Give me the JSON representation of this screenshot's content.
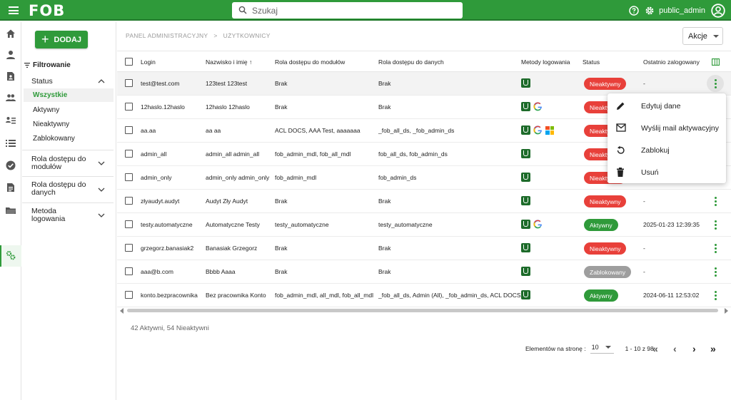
{
  "app": {
    "logo": "FOB",
    "user": "public_admin"
  },
  "search": {
    "placeholder": "Szukaj"
  },
  "sidebar": {
    "add_label": "DODAJ",
    "filter_title": "Filtrowanie"
  },
  "filters": {
    "status": {
      "label": "Status",
      "options": [
        "Wszystkie",
        "Aktywny",
        "Nieaktywny",
        "Zablokowany"
      ],
      "selected": "Wszystkie"
    },
    "rola_modulow": {
      "line1": "Rola dostępu do",
      "line2": "modułów"
    },
    "rola_danych": {
      "line1": "Rola dostępu do",
      "line2": "danych"
    },
    "metoda": {
      "line1": "Metoda",
      "line2": "logowania"
    }
  },
  "breadcrumb": {
    "level1": "PANEL ADMINISTRACYJNY",
    "sep": ">",
    "level2": "UŻYTKOWNICY"
  },
  "actions": {
    "label": "Akcje"
  },
  "table": {
    "headers": {
      "login": "Login",
      "name": "Nazwisko i imię",
      "sort_arrow": "↑",
      "role_modules": "Rola dostępu do modułów",
      "role_data": "Rola dostępu do danych",
      "methods": "Metody logowania",
      "status": "Status",
      "last_login": "Ostatnio zalogowany"
    },
    "rows": [
      {
        "login": "test@test.com",
        "name": "123test 123test",
        "role_modules": "Brak",
        "role_data": "Brak",
        "methods": [
          "fob"
        ],
        "status": "Nieaktywny",
        "status_color": "#e8403a",
        "last": "-"
      },
      {
        "login": "12haslo.12haslo",
        "name": "12haslo 12haslo",
        "role_modules": "Brak",
        "role_data": "Brak",
        "methods": [
          "fob",
          "google"
        ],
        "status": "Nieaktywny",
        "status_color": "#e8403a",
        "last": ""
      },
      {
        "login": "aa.aa",
        "name": "aa aa",
        "role_modules": "ACL DOCS, AAA Test, aaaaaaa",
        "role_data": "_fob_all_ds, _fob_admin_ds",
        "methods": [
          "fob",
          "google",
          "microsoft"
        ],
        "status": "Nieaktywny",
        "status_color": "#e8403a",
        "last": ""
      },
      {
        "login": "admin_all",
        "name": "admin_all admin_all",
        "role_modules": "fob_admin_mdl, fob_all_mdl",
        "role_data": "fob_all_ds, fob_admin_ds",
        "methods": [
          "fob"
        ],
        "status": "Nieaktywny",
        "status_color": "#e8403a",
        "last": ""
      },
      {
        "login": "admin_only",
        "name": "admin_only admin_only",
        "role_modules": "fob_admin_mdl",
        "role_data": "fob_admin_ds",
        "methods": [
          "fob"
        ],
        "status": "Nieaktywny",
        "status_color": "#e8403a",
        "last": ""
      },
      {
        "login": "złyaudyt.audyt",
        "name": "Audyt Zły Audyt",
        "role_modules": "Brak",
        "role_data": "Brak",
        "methods": [
          "fob"
        ],
        "status": "Nieaktywny",
        "status_color": "#e8403a",
        "last": "-"
      },
      {
        "login": "testy.automatyczne",
        "name": "Automatyczne Testy",
        "role_modules": "testy_automatyczne",
        "role_data": "testy_automatyczne",
        "methods": [
          "fob",
          "google"
        ],
        "status": "Aktywny",
        "status_color": "#2f9a3a",
        "last": "2025-01-23 12:39:35"
      },
      {
        "login": "grzegorz.banasiak2",
        "name": "Banasiak Grzegorz",
        "role_modules": "Brak",
        "role_data": "Brak",
        "methods": [
          "fob"
        ],
        "status": "Nieaktywny",
        "status_color": "#e8403a",
        "last": "-"
      },
      {
        "login": "aaa@b.com",
        "name": "Bbbb Aaaa",
        "role_modules": "Brak",
        "role_data": "Brak",
        "methods": [
          "fob"
        ],
        "status": "Zablokowany",
        "status_color": "#9e9e9e",
        "last": "-"
      },
      {
        "login": "konto.bezpracownika",
        "name": "Bez pracownika Konto",
        "role_modules": "fob_admin_mdl, all_mdl, fob_all_mdl",
        "role_data": "_fob_all_ds, Admin (All), _fob_admin_ds, ACL DOCS",
        "methods": [
          "fob"
        ],
        "status": "Aktywny",
        "status_color": "#2f9a3a",
        "last": "2024-06-11 12:53:02"
      }
    ]
  },
  "summary": "42 Aktywni, 54 Nieaktywni",
  "pagination": {
    "per_page_label": "Elementów na stronę :",
    "per_page": "10",
    "range": "1 - 10 z 98"
  },
  "context_menu": {
    "items": [
      {
        "label": "Edytuj dane",
        "icon": "pencil-icon"
      },
      {
        "label": "Wyślij mail aktywacyjny",
        "icon": "mail-icon"
      },
      {
        "label": "Zablokuj",
        "icon": "refresh-icon"
      },
      {
        "label": "Usuń",
        "icon": "trash-icon"
      }
    ]
  },
  "colors": {
    "brand": "#2f9a3a",
    "inactive": "#e8403a",
    "blocked": "#9e9e9e"
  }
}
